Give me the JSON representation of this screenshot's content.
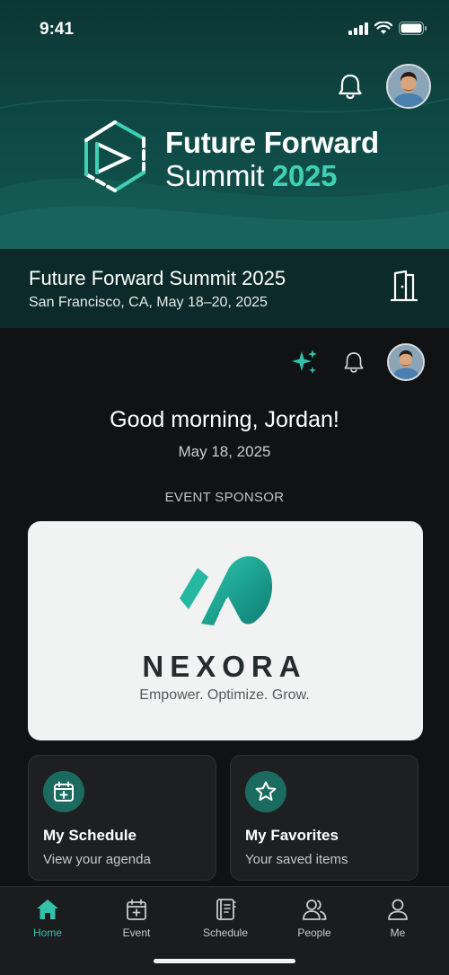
{
  "status_bar": {
    "time": "9:41"
  },
  "hero": {
    "title_line1": "Future Forward",
    "title_line2_prefix": "Summit",
    "title_line2_year": "2025"
  },
  "event": {
    "name": "Future Forward Summit 2025",
    "meta": "San Francisco, CA, May 18–20, 2025"
  },
  "home": {
    "greeting": "Good morning, Jordan!",
    "date": "May 18, 2025",
    "sponsor_label": "EVENT SPONSOR"
  },
  "sponsor": {
    "name": "NEXORA",
    "tagline": "Empower. Optimize. Grow."
  },
  "quick_actions": [
    {
      "title": "My Schedule",
      "subtitle": "View your agenda",
      "icon": "calendar-plus-icon"
    },
    {
      "title": "My Favorites",
      "subtitle": "Your saved items",
      "icon": "star-icon"
    }
  ],
  "nav": [
    {
      "label": "Home",
      "icon": "home-icon",
      "active": true
    },
    {
      "label": "Event",
      "icon": "calendar-icon"
    },
    {
      "label": "Schedule",
      "icon": "schedule-book-icon"
    },
    {
      "label": "People",
      "icon": "people-icon"
    },
    {
      "label": "Me",
      "icon": "person-icon"
    }
  ],
  "colors": {
    "accent": "#32c2aa",
    "hero_bg": "#0f4a46",
    "page_bg": "#111214",
    "card_bg": "#1d1f21"
  }
}
